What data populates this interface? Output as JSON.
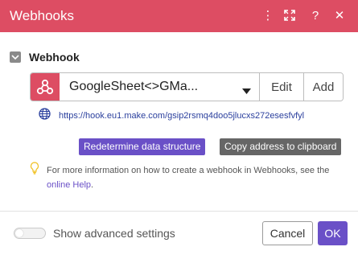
{
  "header": {
    "title": "Webhooks",
    "icons": [
      "more-vertical-icon",
      "fullscreen-icon",
      "help-icon",
      "close-icon"
    ],
    "more_glyph": "⋮",
    "help_glyph": "?",
    "close_glyph": "✕"
  },
  "section": {
    "title": "Webhook"
  },
  "webhook": {
    "selected": "GoogleSheet<>GMa...",
    "edit_label": "Edit",
    "add_label": "Add",
    "url": "https://hook.eu1.make.com/gsip2rsmq4doo5jlucxs272esesfvfyl"
  },
  "actions": {
    "redetermine_label": "Redetermine data structure",
    "copy_label": "Copy address to clipboard"
  },
  "info": {
    "text_before": "For more information on how to create a webhook in Webhooks, see the ",
    "link_text": "online Help",
    "text_after": "."
  },
  "footer": {
    "advanced_label": "Show advanced settings",
    "advanced_enabled": false,
    "cancel_label": "Cancel",
    "ok_label": "OK"
  },
  "colors": {
    "header_bg": "#dd4d63",
    "primary": "#6a50c7",
    "secondary_btn": "#666666",
    "link": "#2a3f9d"
  }
}
